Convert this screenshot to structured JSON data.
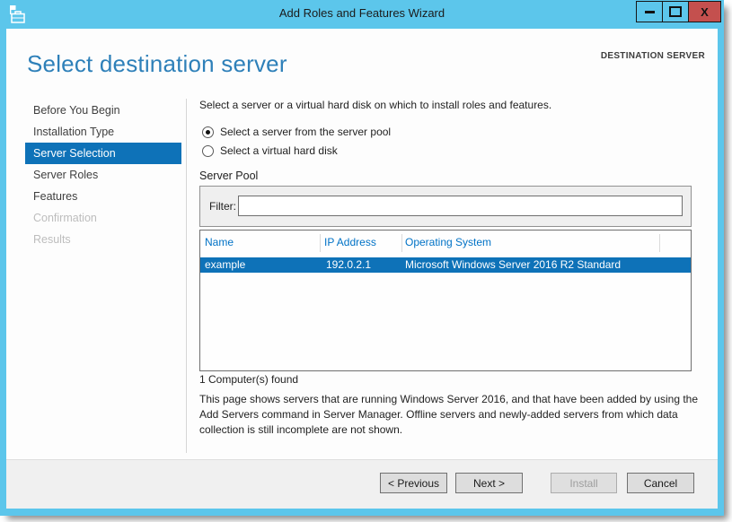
{
  "window": {
    "title": "Add Roles and Features Wizard",
    "close_glyph": "X",
    "icons": {
      "app_icon": "server-manager-toolbox-icon",
      "minimize": "minimize-icon",
      "maximize": "maximize-icon",
      "close": "close-icon"
    }
  },
  "header": {
    "title": "Select destination server",
    "context_label": "DESTINATION SERVER"
  },
  "sidebar": {
    "items": [
      {
        "label": "Before You Begin",
        "state": "normal"
      },
      {
        "label": "Installation Type",
        "state": "normal"
      },
      {
        "label": "Server Selection",
        "state": "active"
      },
      {
        "label": "Server Roles",
        "state": "normal"
      },
      {
        "label": "Features",
        "state": "normal"
      },
      {
        "label": "Confirmation",
        "state": "disabled"
      },
      {
        "label": "Results",
        "state": "disabled"
      }
    ]
  },
  "main": {
    "intro": "Select a server or a virtual hard disk on which to install roles and features.",
    "radios": [
      {
        "label": "Select a server from the server pool",
        "selected": true
      },
      {
        "label": "Select a virtual hard disk",
        "selected": false
      }
    ],
    "server_pool": {
      "section_label": "Server Pool",
      "filter_label": "Filter:",
      "filter_value": "",
      "table": {
        "columns": [
          "Name",
          "IP Address",
          "Operating System"
        ],
        "rows": [
          {
            "name": "example",
            "ip": "192.0.2.1",
            "os": "Microsoft Windows Server 2016 R2 Standard",
            "selected": true
          }
        ]
      },
      "count_text": "1 Computer(s) found"
    },
    "description": "This page shows servers that are running Windows Server 2016, and that have been added by using the Add Servers command in Server Manager. Offline servers and newly-added servers from which data collection is still incomplete are not shown."
  },
  "footer": {
    "buttons": [
      {
        "label": "< Previous",
        "enabled": true
      },
      {
        "label": "Next >",
        "enabled": true
      },
      {
        "label": "Install",
        "enabled": false
      },
      {
        "label": "Cancel",
        "enabled": true
      }
    ]
  },
  "colors": {
    "titlebar": "#5CC6EB",
    "close_button": "#C4504E",
    "selection": "#0E72B8",
    "heading": "#2E80B9",
    "table_header_text": "#0072C6",
    "footer_bg": "#F0F0F0"
  }
}
